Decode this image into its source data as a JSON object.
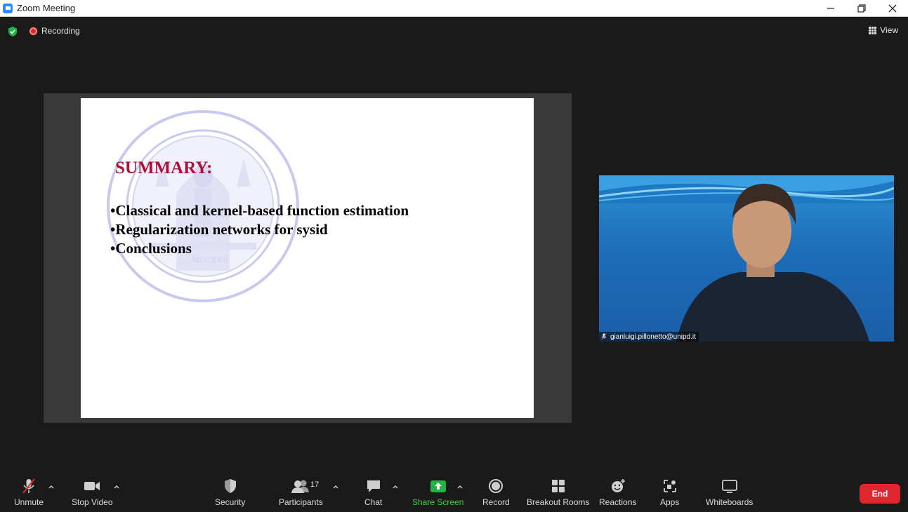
{
  "window": {
    "title": "Zoom Meeting"
  },
  "topbar": {
    "recording_label": "Recording",
    "view_label": "View"
  },
  "slide": {
    "title": "SUMMARY:",
    "bullets": [
      "•Classical and kernel-based function estimation",
      "•Regularization networks for sysid",
      "•Conclusions"
    ],
    "seal_text": "MCCXXII"
  },
  "video": {
    "participant_name": "gianluigi.pillonetto@unipd.it"
  },
  "toolbar": {
    "unmute": "Unmute",
    "stop_video": "Stop Video",
    "security": "Security",
    "participants": "Participants",
    "participants_count": "17",
    "chat": "Chat",
    "share_screen": "Share Screen",
    "record": "Record",
    "breakout_rooms": "Breakout Rooms",
    "reactions": "Reactions",
    "apps": "Apps",
    "whiteboards": "Whiteboards",
    "end": "End"
  },
  "colors": {
    "share_green": "#3fd13f",
    "end_red": "#e0262f",
    "recording_red": "#e02828",
    "slide_title": "#a8143a"
  }
}
